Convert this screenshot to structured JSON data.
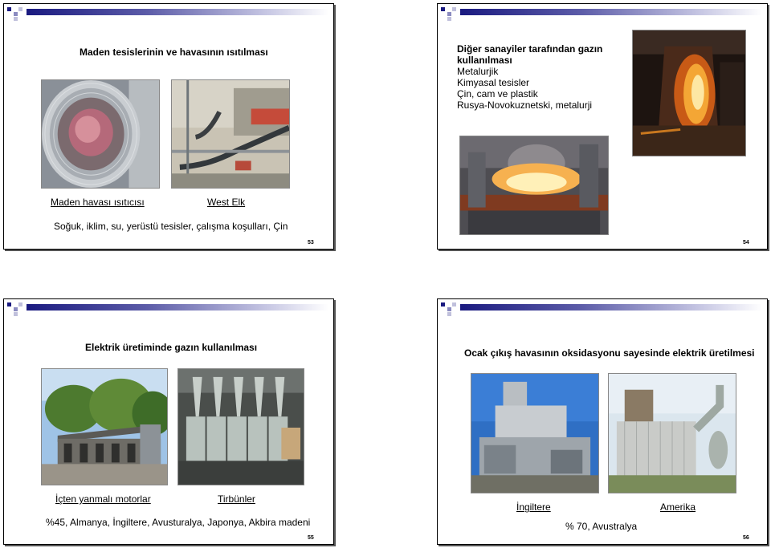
{
  "slides": [
    {
      "title": "Maden tesislerinin ve havasının ısıtılması",
      "captions": [
        "Maden havası ısıtıcısı",
        "West Elk"
      ],
      "body": "Soğuk, iklim, su, yerüstü tesisler, çalışma koşulları, Çin",
      "page": "53"
    },
    {
      "title_lines": [
        "Diğer sanayiler tarafından gazın",
        "kullanılması"
      ],
      "lines": [
        "Metalurjik",
        "Kimyasal tesisler",
        "Çin, cam ve plastik",
        "Rusya-Novokuznetski, metalurji"
      ],
      "page": "54"
    },
    {
      "title": "Elektrik üretiminde gazın kullanılması",
      "captions": [
        "İçten yanmalı motorlar",
        "Tirbünler"
      ],
      "body": "%45, Almanya, İngiltere, Avusturalya, Japonya, Akbira madeni",
      "page": "55"
    },
    {
      "title": "Ocak çıkış havasının oksidasyonu sayesinde elektrik üretilmesi",
      "captions": [
        "İngiltere",
        "Amerika"
      ],
      "body": "% 70, Avustralya",
      "page": "56"
    }
  ],
  "photos": {
    "heater": "air-heater-duct-photo",
    "pipes": "west-elk-pipes-photo",
    "furnace1": "metallurgy-furnace-photo",
    "furnace2": "steel-converter-photo",
    "engines": "engine-shed-photo",
    "turbines": "turbine-hall-photo",
    "england": "england-plant-photo",
    "america": "america-plant-photo"
  }
}
